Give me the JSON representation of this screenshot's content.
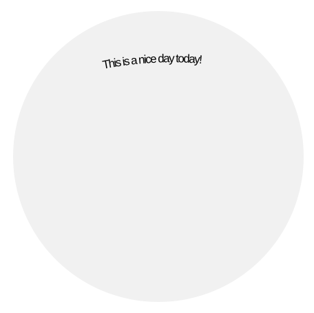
{
  "circle": {
    "fill": "#f1f1f1"
  },
  "curved_text": {
    "text": "This is a nice day today!",
    "color": "#000000"
  }
}
